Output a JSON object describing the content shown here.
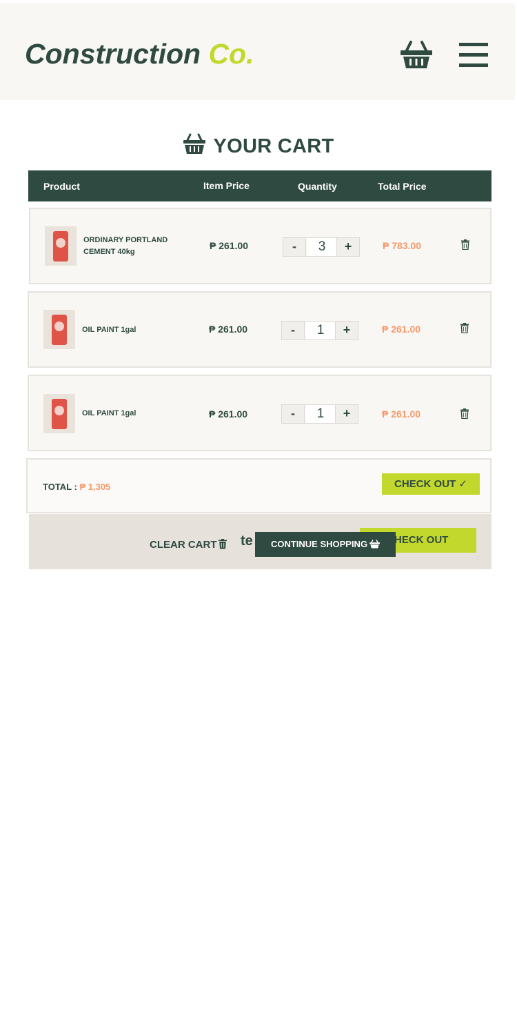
{
  "header": {
    "logo_main": "Construction",
    "logo_accent": "Co.",
    "cart_icon": "basket-icon",
    "menu_icon": "hamburger-menu-icon"
  },
  "cart": {
    "title": "YOUR CART",
    "columns": {
      "product": "Product",
      "item_price": "Item Price",
      "quantity": "Quantity",
      "total_price": "Total Price"
    },
    "items": [
      {
        "name_line1": "ORDINARY PORTLAND",
        "name_line2": "CEMENT 40kg",
        "price": "₱ 261.00",
        "qty": "3",
        "total": "₱ 783.00",
        "minus": "-",
        "plus": "+"
      },
      {
        "name_line1": "OIL PAINT 1gal",
        "name_line2": "",
        "price": "₱ 261.00",
        "qty": "1",
        "total": "₱ 261.00",
        "minus": "-",
        "plus": "+"
      },
      {
        "name_line1": "OIL PAINT 1gal",
        "name_line2": "",
        "price": "₱ 261.00",
        "qty": "1",
        "total": "₱ 261.00",
        "minus": "-",
        "plus": "+"
      }
    ],
    "summary": {
      "label": "TOTAL :",
      "value": "₱ 1,305",
      "checkout_label": "CHECK OUT ✓"
    },
    "footer": {
      "clear_cart": "CLEAR CART",
      "stray_text": "te",
      "checkout_label": "HECK OUT",
      "continue_label": "CONTINUE SHOPPING"
    }
  },
  "colors": {
    "dark_green": "#2f4a40",
    "lime": "#c2d82c",
    "orange": "#f49a6c",
    "panel_bg": "#f8f7f4",
    "footer_bg": "#e6e1db"
  }
}
